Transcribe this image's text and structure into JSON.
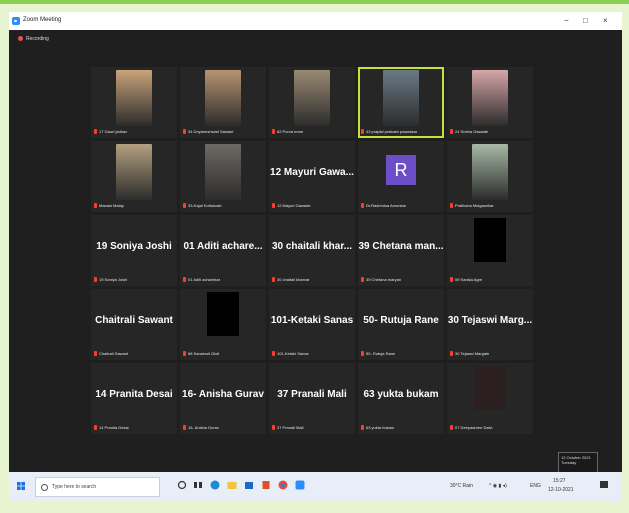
{
  "window": {
    "title": "Zoom Meeting",
    "recording_label": "Recording",
    "controls": {
      "minimize": "−",
      "maximize": "□",
      "close": "×"
    }
  },
  "participants": [
    {
      "name": "17 Gauri jadhav",
      "type": "video"
    },
    {
      "name": "34 Dnyaneshwari Sawant",
      "type": "video"
    },
    {
      "name": "82 Purva more",
      "type": "video"
    },
    {
      "name": "43 prajakt prakash pawaskar",
      "type": "video",
      "active": true
    },
    {
      "name": "24 Sneha Gawade",
      "type": "video"
    },
    {
      "name": "Manasi Malap",
      "type": "video"
    },
    {
      "name": "33-Kajal Kothavale",
      "type": "video"
    },
    {
      "name": "12 Mayuri Gawade",
      "type": "name",
      "display": "12 Mayuri Gawa..."
    },
    {
      "name": "Dr.Rashmina Amonkar",
      "type": "avatar",
      "initial": "R"
    },
    {
      "name": "Pratiksha Mulgaonkar",
      "type": "video"
    },
    {
      "name": "19 Soniya Joshi",
      "type": "name",
      "display": "19 Soniya Joshi"
    },
    {
      "name": "01 Aditi acharekar",
      "type": "name",
      "display": "01 Aditi achare..."
    },
    {
      "name": "30 chaitali kharvat",
      "type": "name",
      "display": "30 chaitali khar..."
    },
    {
      "name": "39 Chetana maryan",
      "type": "name",
      "display": "39 Chetana man..."
    },
    {
      "name": "59 Sanika Agre",
      "type": "black"
    },
    {
      "name": "Chaitrali Sawant",
      "type": "name",
      "display": "Chaitrali Sawant"
    },
    {
      "name": "68 Sanskruti Dixit",
      "type": "black"
    },
    {
      "name": "101-Ketaki Sanas",
      "type": "name",
      "display": "101-Ketaki Sanas"
    },
    {
      "name": "50- Rutuja Rane",
      "type": "name",
      "display": "50- Rutuja Rane"
    },
    {
      "name": "30 Tejaswi Margale",
      "type": "name",
      "display": "30 Tejaswi Marg..."
    },
    {
      "name": "14 Pranita Desai",
      "type": "name",
      "display": "14 Pranita Desai"
    },
    {
      "name": "16- Anisha Gurav",
      "type": "name",
      "display": "16- Anisha Gurav"
    },
    {
      "name": "37 Pranali Mali",
      "type": "name",
      "display": "37 Pranali Mali"
    },
    {
      "name": "63 yukta bukam",
      "type": "name",
      "display": "63 yukta bukam"
    },
    {
      "name": "07 Deepashree Dalvi",
      "type": "dark"
    }
  ],
  "clock_popup": {
    "date": "12 October 2021",
    "day": "Tuesday"
  },
  "taskbar": {
    "search_placeholder": "Type here to search",
    "weather": "30°C Rain",
    "language": "ENG",
    "time": "15:27",
    "date": "12-10-2021"
  },
  "colors": {
    "background": "#e6f4cf",
    "active_speaker": "#c4e23a",
    "avatar": "#6c4fc6",
    "muted_mic": "#ff3b30"
  }
}
